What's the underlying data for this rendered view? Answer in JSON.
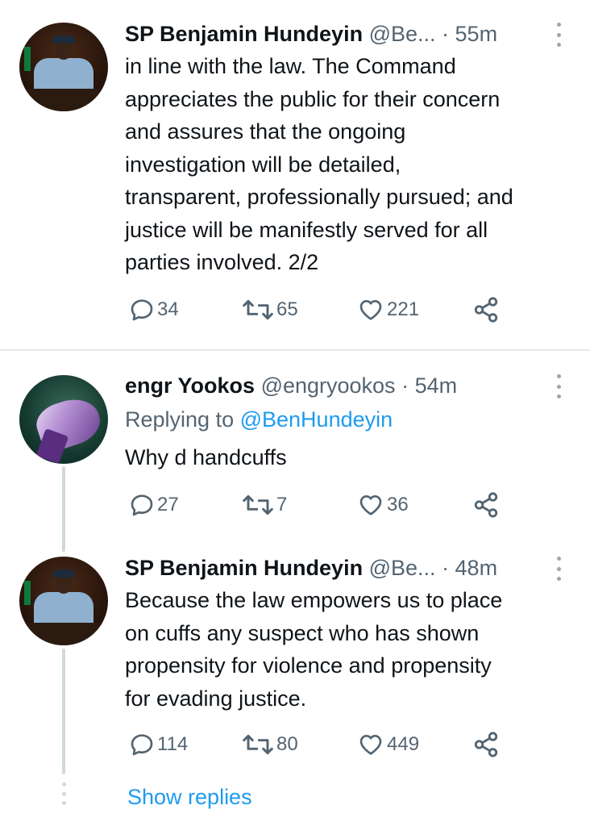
{
  "tweets": [
    {
      "name": "SP Benjamin Hundeyin",
      "handle": "@Be...",
      "time": "· 55m",
      "avatar": "police-officer-avatar",
      "lines": [
        "in line with the law. The Command",
        "appreciates the public for their concern",
        "and assures that the ongoing",
        "investigation will be detailed,",
        "transparent, professionally pursued; and",
        "justice will be manifestly served for all",
        "parties involved. 2/2"
      ],
      "replies": "34",
      "retweets": "65",
      "likes": "221"
    },
    {
      "name": "engr Yookos",
      "handle": "@engryookos",
      "time": "· 54m",
      "avatar": "handcuffed-hands-avatar",
      "replying_prefix": "Replying to",
      "replying_handle": "@BenHundeyin",
      "lines": [
        "Why d handcuffs"
      ],
      "replies": "27",
      "retweets": "7",
      "likes": "36"
    },
    {
      "name": "SP Benjamin Hundeyin",
      "handle": "@Be...",
      "time": "· 48m",
      "avatar": "police-officer-avatar",
      "lines": [
        "Because the law empowers us to place",
        "on cuffs any suspect who has shown",
        "propensity for violence and propensity",
        "for evading justice."
      ],
      "replies": "114",
      "retweets": "80",
      "likes": "449"
    }
  ],
  "show_replies": "Show replies",
  "colors": {
    "text": "#0f1419",
    "muted": "#536471",
    "accent": "#1d9bf0",
    "divider": "#e8eaec",
    "thread": "#cfd9de"
  },
  "icons": [
    "reply-icon",
    "retweet-icon",
    "like-icon",
    "share-icon",
    "more-icon"
  ]
}
